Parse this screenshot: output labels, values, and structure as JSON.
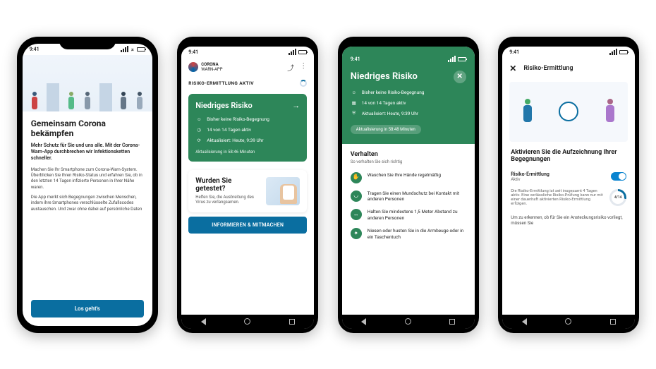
{
  "statusbar": {
    "time": "9:41"
  },
  "phone1": {
    "title": "Gemeinsam Corona bekämpfen",
    "lead": "Mehr Schutz für Sie und uns alle. Mit der Corona-Warn-App durchbrechen wir Infektionsketten schneller.",
    "para1": "Machen Sie Ihr Smartphone zum Corona-Warn-System. Überblicken Sie Ihren Risiko-Status und erfahren Sie, ob in den letzten 14 Tagen infizierte Personen in Ihrer Nähe waren.",
    "para2": "Die App merkt sich Begegnungen zwischen Menschen, indem ihre Smartphones verschlüsselte Zufallscodes austauschen. Und zwar ohne dabei auf persönliche Daten",
    "cta": "Los geht's"
  },
  "phone2": {
    "brand_line1": "CORONA",
    "brand_line2": "WARN-APP",
    "status": "RISIKO-ERMITTLUNG AKTIV",
    "card_title": "Niedriges Risiko",
    "items": [
      "Bisher keine Risiko-Begegnung",
      "14 von 14 Tagen aktiv",
      "Aktualisiert: Heute, 9:39 Uhr"
    ],
    "card_footer": "Aktualisierung in 58:46 Minuten",
    "tested_title": "Wurden Sie getestet?",
    "tested_body": "Helfen Sie, die Ausbreitung des Virus zu verlangsamen.",
    "tested_cta": "INFORMIEREN & MITMACHEN"
  },
  "phone3": {
    "title": "Niedriges Risiko",
    "items": [
      "Bisher keine Risiko-Begegnung",
      "14 von 14 Tagen aktiv",
      "Aktualisiert: Heute, 9:39 Uhr"
    ],
    "update_pill": "Aktualisierung in 58:48 Minuten",
    "behave_title": "Verhalten",
    "behave_sub": "So verhalten Sie sich richtig",
    "behave": [
      "Waschen Sie Ihre Hände regelmäßig",
      "Tragen Sie einen Mundschutz bei Kontakt mit anderen Personen",
      "Halten Sie mindestens 1,5 Meter Abstand zu anderen Personen",
      "Niesen oder husten Sie in die Armbeuge oder in ein Taschentuch"
    ]
  },
  "phone4": {
    "header": "Risiko-Ermittlung",
    "headline": "Aktivieren Sie die Aufzeichnung Ihrer Begegnungen",
    "toggle_label": "Risiko-Ermittlung",
    "toggle_sub": "Aktiv",
    "info": "Die Risiko-Ermittlung ist seit insgesamt 4 Tagen aktiv. Eine verlässliche Risiko-Prüfung kann nur mit einer dauerhaft aktivierten Risiko-Ermittlung erfolgen.",
    "gauge": "4/14",
    "more": "Um zu erkennen, ob für Sie ein Ansteckungsrisiko vorliegt, müssen Sie"
  }
}
